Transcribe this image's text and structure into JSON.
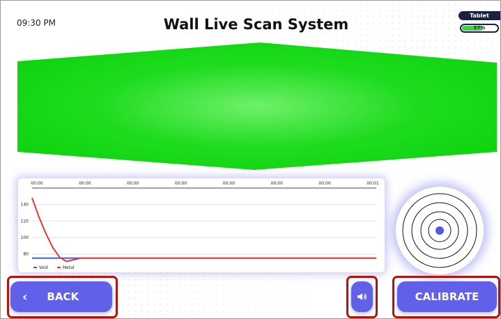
{
  "status_bar": {
    "time": "09:30 PM",
    "device": "Tablet",
    "battery_label": "57%",
    "battery_level": 0.57
  },
  "header": {
    "title": "Wall Live Scan System"
  },
  "scan_display": {
    "color": "#22dd22"
  },
  "chart_data": {
    "type": "line",
    "x_tick_labels": [
      "00:00",
      "00:00",
      "00:00",
      "00:00",
      "00:00",
      "00:00",
      "00:00",
      "00:01"
    ],
    "y_tick_labels": [
      "140",
      "120",
      "100",
      "80"
    ],
    "ylim": [
      62,
      160
    ],
    "xlim": [
      0,
      100
    ],
    "grid": true,
    "legend_position": "bottom-left",
    "series": [
      {
        "name": "Void",
        "color": "#3b5bdb",
        "x": [
          0,
          5,
          10,
          100
        ],
        "y": [
          75,
          75,
          75,
          75
        ]
      },
      {
        "name": "Metal",
        "color": "#e53935",
        "x": [
          0,
          2,
          4,
          6,
          8,
          10,
          12,
          14,
          100
        ],
        "y": [
          148,
          125,
          105,
          88,
          76,
          71,
          73,
          75,
          75
        ]
      }
    ]
  },
  "controls": {
    "back_label": "BACK",
    "back_icon": "chevron-left-icon",
    "sound_icon": "speaker-icon",
    "calibrate_label": "CALIBRATE"
  },
  "colors": {
    "button": "#6060e8",
    "outline": "#b4130c",
    "badge": "#1c2140"
  }
}
